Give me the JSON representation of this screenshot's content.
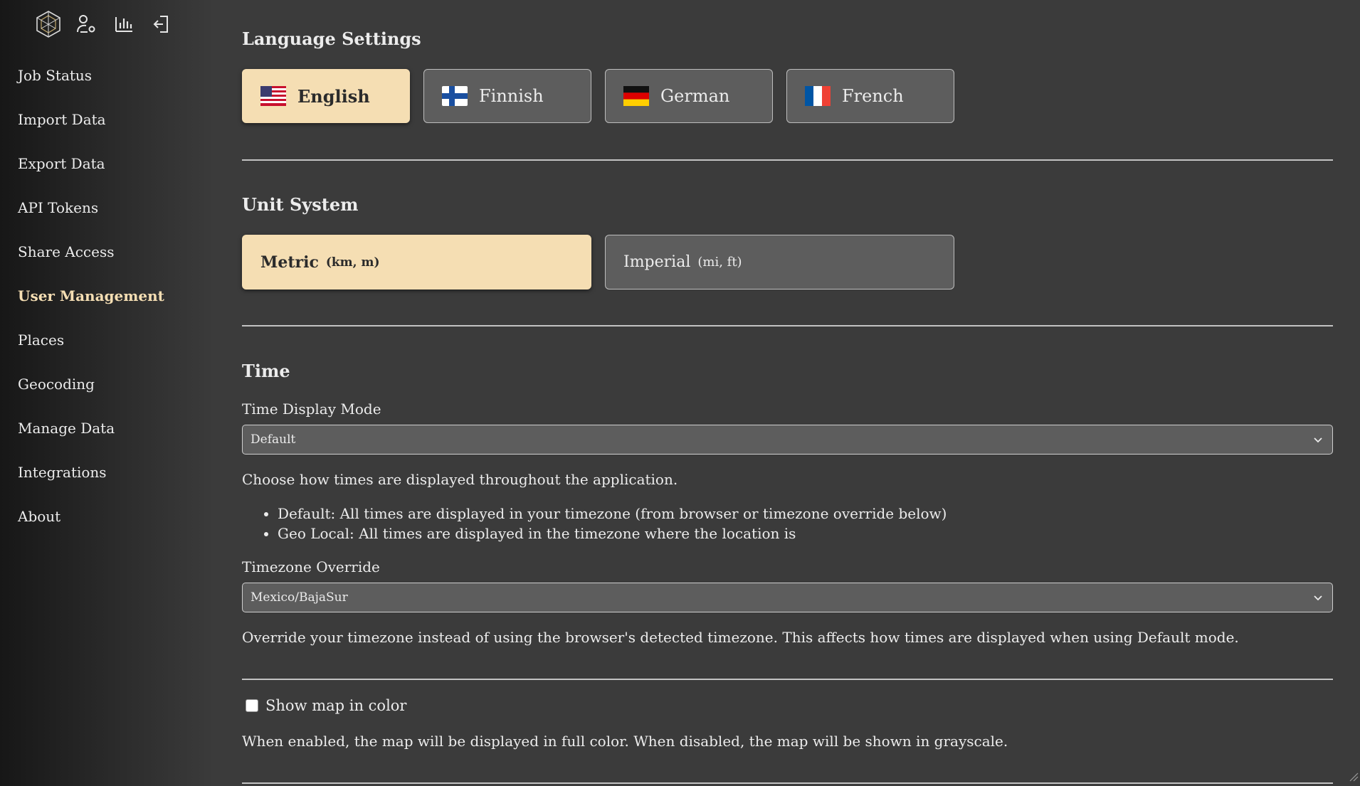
{
  "nav": {
    "icons": [
      "logo-icon",
      "user-settings-icon",
      "chart-icon",
      "logout-icon"
    ],
    "items": [
      {
        "label": "Job Status"
      },
      {
        "label": "Import Data"
      },
      {
        "label": "Export Data"
      },
      {
        "label": "API Tokens"
      },
      {
        "label": "Share Access"
      },
      {
        "label": "User Management",
        "active": true
      },
      {
        "label": "Places"
      },
      {
        "label": "Geocoding"
      },
      {
        "label": "Manage Data"
      },
      {
        "label": "Integrations"
      },
      {
        "label": "About"
      }
    ]
  },
  "language": {
    "title": "Language Settings",
    "options": [
      {
        "label": "English",
        "flag": "us-flag-icon",
        "selected": true
      },
      {
        "label": "Finnish",
        "flag": "finland-flag-icon",
        "selected": false
      },
      {
        "label": "German",
        "flag": "germany-flag-icon",
        "selected": false
      },
      {
        "label": "French",
        "flag": "france-flag-icon",
        "selected": false
      }
    ]
  },
  "units": {
    "title": "Unit System",
    "options": [
      {
        "label": "Metric",
        "sub": "(km, m)",
        "selected": true
      },
      {
        "label": "Imperial",
        "sub": "(mi, ft)",
        "selected": false
      }
    ]
  },
  "time": {
    "title": "Time",
    "display_mode_label": "Time Display Mode",
    "display_mode_value": "Default",
    "display_mode_help": "Choose how times are displayed throughout the application.",
    "bullets": [
      "Default: All times are displayed in your timezone (from browser or timezone override below)",
      "Geo Local: All times are displayed in the timezone where the location is"
    ],
    "timezone_label": "Timezone Override",
    "timezone_value": "Mexico/BajaSur",
    "timezone_help": "Override your timezone instead of using the browser's detected timezone. This affects how times are displayed when using Default mode."
  },
  "map": {
    "checkbox_label": "Show map in color",
    "checked": false,
    "help": "When enabled, the map will be displayed in full color. When disabled, the map will be shown in grayscale."
  },
  "colors": {
    "accent": "#f5deb3",
    "background": "#3b3b3b",
    "button_bg": "#5d5d5d"
  }
}
